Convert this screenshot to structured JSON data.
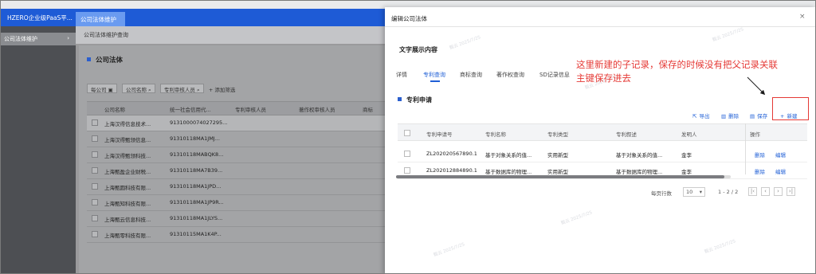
{
  "app": {
    "brand": "HZERO企业级PaaS平...",
    "open_tab": "公司法体维护",
    "sidebar_item": "公司法体维护",
    "breadcrumb": "公司法体维护查询",
    "section_title": "公司法体",
    "filters": [
      "每公司",
      "公司名称",
      "专利审核人员"
    ],
    "add_filter": "+ 添加筛选",
    "filter_icons": [
      "calendar-icon",
      "search-icon",
      "search-icon"
    ],
    "table": {
      "headers": [
        "公司名称",
        "统一社会信用代...",
        "专利审核人员",
        "著作权审核人员",
        "商标"
      ],
      "rows": [
        {
          "name": "上海汉得信息技术...",
          "code": "9131000074027295..."
        },
        {
          "name": "上海汉得甄领信息...",
          "code": "91310118MA1JMJ..."
        },
        {
          "name": "上海汉得甄领科技...",
          "code": "91310118MABQK8..."
        },
        {
          "name": "上海甄盈企业财税...",
          "code": "91310118MA7B39..."
        },
        {
          "name": "上海甄圆科技有限...",
          "code": "91310118MA1JPD..."
        },
        {
          "name": "上海甄知科技有限...",
          "code": "91310118MA1JP9R..."
        },
        {
          "name": "上海甄云信息科技...",
          "code": "91310118MA1JLYS..."
        },
        {
          "name": "上海甄零科技有限...",
          "code": "91310115MA1K4P..."
        }
      ]
    }
  },
  "dialog": {
    "title": "编辑公司法体",
    "close_icon": "close-icon",
    "text_section": "文字展示内容",
    "tabs": [
      "详情",
      "专利查询",
      "商标查询",
      "著作权查询",
      "SD记录信息"
    ],
    "active_tab": "专利查询",
    "section": "专利申请",
    "toolbar": [
      {
        "label": "导出",
        "icon": "export-icon"
      },
      {
        "label": "删除",
        "icon": "trash-icon"
      },
      {
        "label": "保存",
        "icon": "save-icon"
      },
      {
        "label": "新建",
        "icon": "plus-icon"
      }
    ],
    "table": {
      "headers": [
        "专利申请号",
        "专利名称",
        "专利类型",
        "专利叙述",
        "发明人",
        "操作"
      ],
      "rows": [
        {
          "no": "ZL202020567890.1",
          "name": "基于对象关系的值...",
          "type": "实用新型",
          "desc": "基于对象关系的值...",
          "inventor": "金李",
          "delete": "删除",
          "edit": "编辑"
        },
        {
          "no": "ZL202012884890.1",
          "name": "基于数据库的物理...",
          "type": "实用新型",
          "desc": "基于数据库的物理...",
          "inventor": "金李",
          "delete": "删除",
          "edit": "编辑"
        }
      ]
    },
    "pagination": {
      "per_page_label": "每页行数",
      "per_page": "10",
      "range": "1 - 2 / 2"
    }
  },
  "annotation": {
    "line1": "这里新建的子记录，保存的时候没有把父记录关联",
    "line2": "主键保存进去",
    "color": "#e53935"
  },
  "watermark": "甄云 2025/7/25"
}
